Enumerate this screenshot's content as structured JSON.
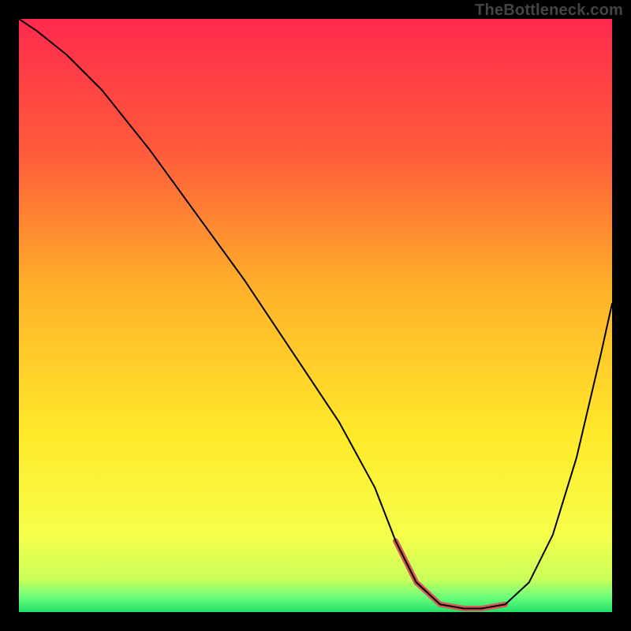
{
  "watermark": "TheBottleneck.com",
  "chart_data": {
    "type": "line",
    "title": "",
    "xlabel": "",
    "ylabel": "",
    "xlim": [
      0,
      100
    ],
    "ylim": [
      0,
      100
    ],
    "gradient_stops": [
      {
        "offset": 0,
        "color": "#ff2a4d"
      },
      {
        "offset": 0.22,
        "color": "#ff5a3c"
      },
      {
        "offset": 0.45,
        "color": "#ffb02a"
      },
      {
        "offset": 0.7,
        "color": "#ffe92a"
      },
      {
        "offset": 0.87,
        "color": "#f6ff4a"
      },
      {
        "offset": 0.945,
        "color": "#c9ff5a"
      },
      {
        "offset": 0.975,
        "color": "#6bff7a"
      },
      {
        "offset": 1.0,
        "color": "#22e06a"
      }
    ],
    "series": [
      {
        "name": "bottleneck-curve",
        "color": "#000000",
        "width": 2,
        "x": [
          0,
          3,
          8,
          14,
          22,
          30,
          38,
          46,
          54,
          60,
          63.5,
          67,
          71,
          75,
          78,
          82,
          86,
          90,
          94,
          98,
          100
        ],
        "y": [
          100,
          98,
          94,
          88,
          78,
          67,
          56,
          44,
          32,
          21,
          12,
          5,
          1.3,
          0.6,
          0.6,
          1.3,
          5,
          13,
          26,
          43,
          52
        ]
      }
    ],
    "highlight": {
      "name": "optimum-band",
      "color": "#d65a5a",
      "width": 7,
      "x": [
        63.5,
        67,
        71,
        75,
        78,
        82
      ],
      "y": [
        12,
        5,
        1.3,
        0.6,
        0.6,
        1.3
      ]
    }
  }
}
